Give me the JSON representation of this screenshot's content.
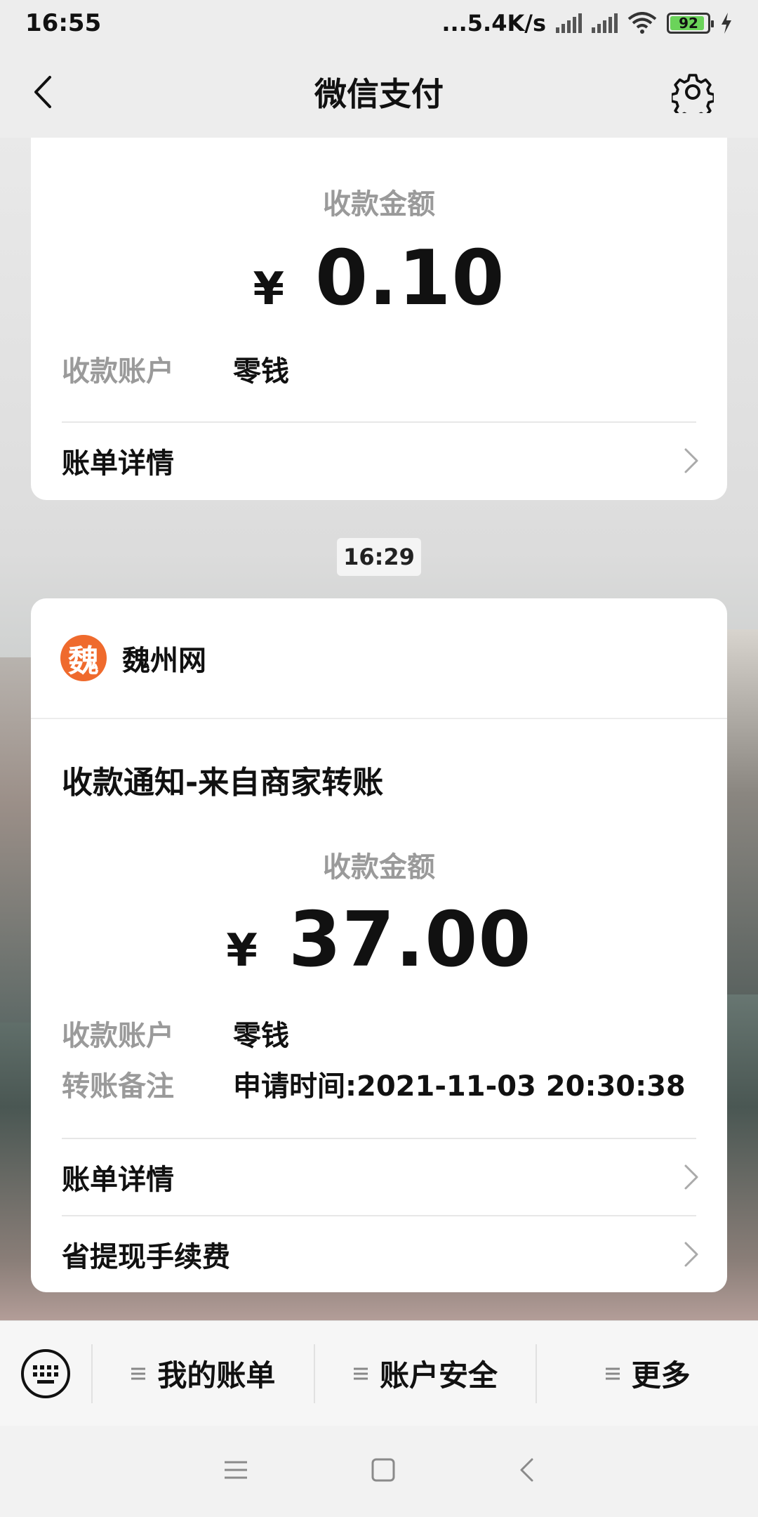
{
  "status_bar": {
    "time": "16:55",
    "network_speed": "...5.4K/s",
    "battery": "92",
    "battery_color": "#6bd35a"
  },
  "header": {
    "title": "微信支付",
    "back_icon": "chevron-left-icon",
    "settings_icon": "gear-icon"
  },
  "card1": {
    "amount_label": "收款金额",
    "currency": "¥",
    "amount": "0.10",
    "account_key": "收款账户",
    "account_value": "零钱",
    "details_label": "账单详情"
  },
  "time_chip": "16:29",
  "card2": {
    "merchant_logo_text": "魏",
    "merchant_name": "魏州网",
    "notice_title": "收款通知-来自商家转账",
    "amount_label": "收款金额",
    "currency": "¥",
    "amount": "37.00",
    "account_key": "收款账户",
    "account_value": "零钱",
    "remark_key": "转账备注",
    "remark_value": "申请时间:2021-11-03 20:30:38",
    "details_label": "账单详情",
    "fee_label": "省提现手续费"
  },
  "bottom_menu": {
    "items": [
      {
        "label": "我的账单"
      },
      {
        "label": "账户安全"
      },
      {
        "label": "更多"
      }
    ]
  },
  "colors": {
    "accent_orange": "#ef6a2d",
    "muted_text": "#9a9a9a"
  }
}
